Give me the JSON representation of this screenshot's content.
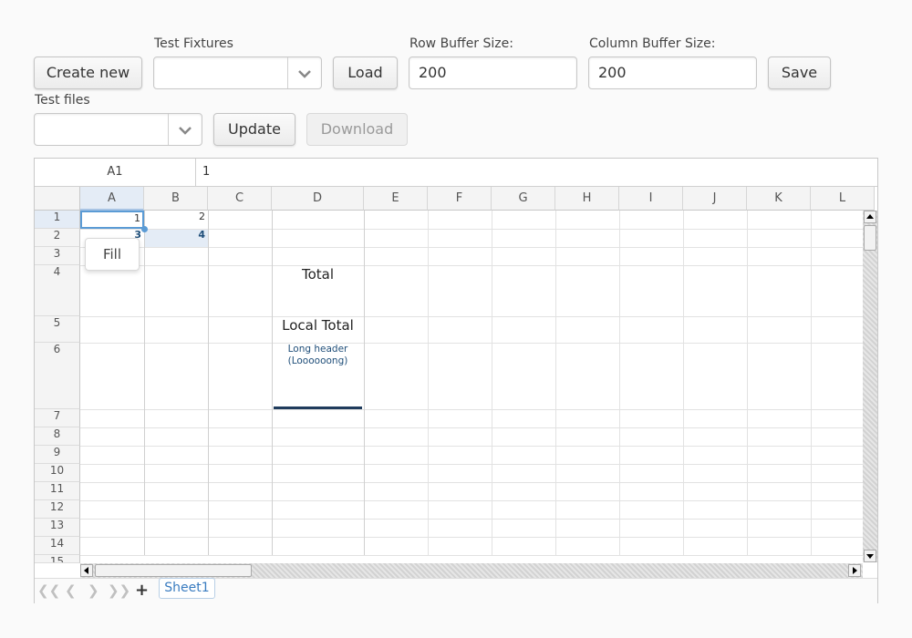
{
  "toolbar": {
    "create_new": "Create new",
    "fixtures_label": "Test Fixtures",
    "fixtures_value": "",
    "load": "Load",
    "row_buffer_label": "Row Buffer Size:",
    "row_buffer_value": "200",
    "col_buffer_label": "Column Buffer Size:",
    "col_buffer_value": "200",
    "save": "Save",
    "files_label": "Test files",
    "files_value": "",
    "update": "Update",
    "download": "Download"
  },
  "formula_bar": {
    "address": "A1",
    "value": "1"
  },
  "columns": [
    "A",
    "B",
    "C",
    "D",
    "E",
    "F",
    "G",
    "H",
    "I",
    "J",
    "K",
    "L"
  ],
  "rows": [
    "1",
    "2",
    "3",
    "4",
    "5",
    "6",
    "7",
    "8",
    "9",
    "10",
    "11",
    "12",
    "13",
    "14",
    "15"
  ],
  "cells": {
    "a1": "1",
    "b1": "2",
    "a2": "3",
    "b2": "4",
    "d4": "Total",
    "d5": "Local Total",
    "d6": "Long header (Loooooong)"
  },
  "popup": {
    "fill": "Fill"
  },
  "sheet_tabs": [
    "Sheet1"
  ],
  "colors": {
    "accent": "#5b9bd5",
    "header_text": "#1f4e79",
    "selection": "#e4ecf6"
  }
}
